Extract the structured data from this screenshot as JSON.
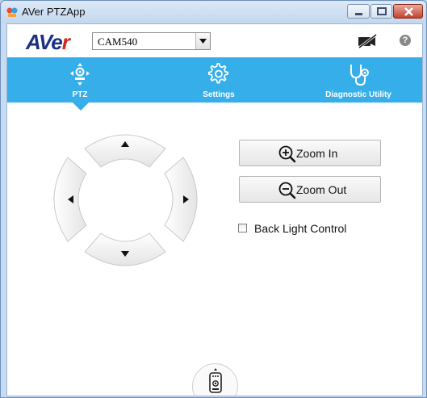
{
  "window": {
    "title": "AVer PTZApp"
  },
  "header": {
    "logo_main": "AVe",
    "logo_accent": "r",
    "camera_select": {
      "selected": "CAM540"
    }
  },
  "tabs": [
    {
      "label": "PTZ",
      "icon": "ptz-camera-icon",
      "active": true
    },
    {
      "label": "Settings",
      "icon": "gear-icon"
    },
    {
      "label": "Diagnostic Utility",
      "icon": "stethoscope-icon"
    }
  ],
  "ptz": {
    "zoom_in": "Zoom In",
    "zoom_out": "Zoom Out",
    "back_light": {
      "label": "Back Light Control",
      "checked": false
    }
  },
  "colors": {
    "accent": "#36aeea",
    "logo_blue": "#1a2f86",
    "logo_red": "#d8251e"
  }
}
